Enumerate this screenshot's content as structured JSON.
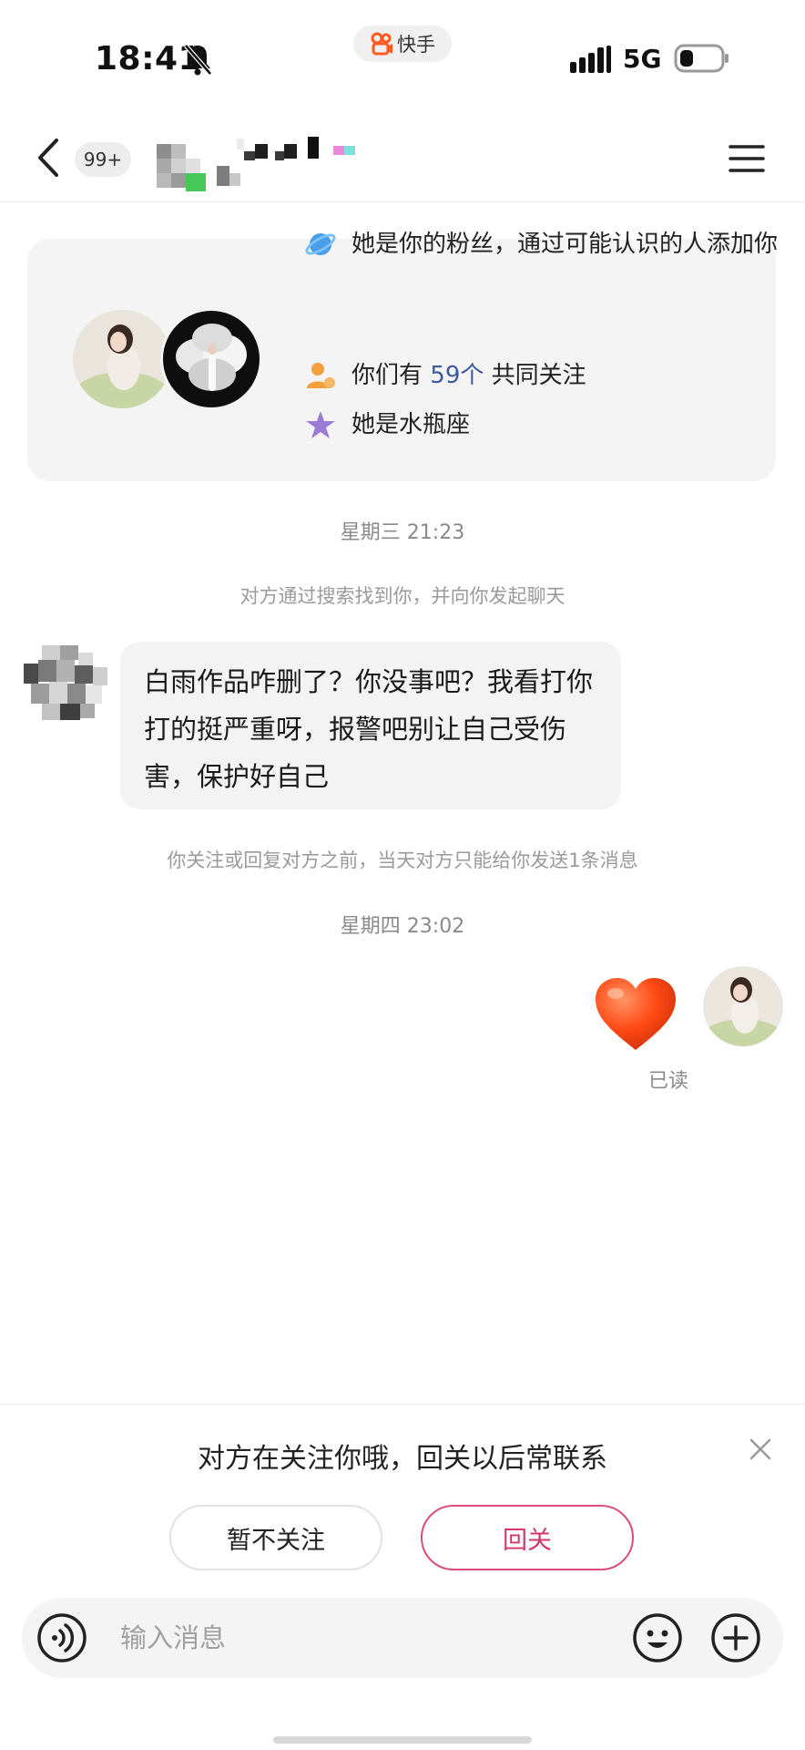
{
  "status_bar": {
    "time": "18:41",
    "app_name": "快手",
    "network": "5G"
  },
  "header": {
    "unread_count": "99+"
  },
  "info_card": {
    "line1": "她是你的粉丝，通过可能认识的人添加你",
    "mutual_prefix": "你们有",
    "mutual_count": "59个",
    "mutual_suffix": "共同关注",
    "line3": "她是水瓶座",
    "colors": {
      "planet": "#4a9ee8",
      "person": "#f2a03c",
      "star": "#9a7bd6"
    }
  },
  "chat": {
    "timestamp1": "星期三 21:23",
    "system_note1": "对方通过搜索找到你，并向你发起聊天",
    "incoming_message": "白雨作品咋删了？你没事吧？我看打你打的挺严重呀，报警吧别让自己受伤害，保护好自己",
    "system_note2": "你关注或回复对方之前，当天对方只能给你发送1条消息",
    "timestamp2": "星期四 23:02",
    "outgoing_sticker": "heart-icon",
    "read_status": "已读"
  },
  "follow_panel": {
    "prompt": "对方在关注你哦，回关以后常联系",
    "decline_label": "暂不关注",
    "follow_label": "回关",
    "accent_color": "#d2386b"
  },
  "composer": {
    "placeholder": "输入消息"
  }
}
